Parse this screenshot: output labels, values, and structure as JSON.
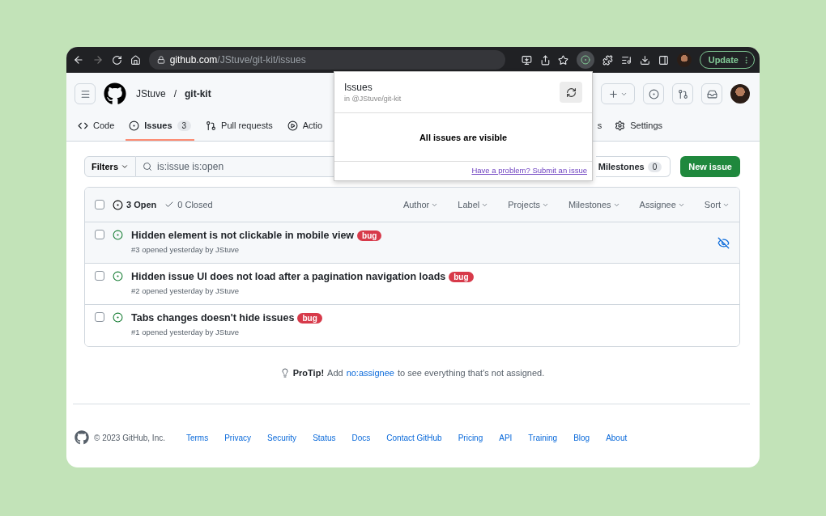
{
  "browser": {
    "url_host": "github.com",
    "url_path": "/JStuve/git-kit/issues",
    "update_button": "Update",
    "extension_active": true
  },
  "repo": {
    "owner": "JStuve",
    "separator": "/",
    "name": "git-kit"
  },
  "tabs_left": [
    {
      "label": "Code",
      "selected": false
    },
    {
      "label": "Issues",
      "count": "3",
      "selected": true
    },
    {
      "label": "Pull requests",
      "selected": false
    },
    {
      "label": "Actio",
      "selected": false
    }
  ],
  "tabs_right": [
    {
      "label": "s",
      "selected": false
    },
    {
      "label": "Settings",
      "selected": false
    }
  ],
  "filters": {
    "button": "Filters",
    "search_value": "is:issue is:open",
    "milestones": "Milestones",
    "milestones_count": "0",
    "new_issue": "New issue"
  },
  "list_header": {
    "checked": false,
    "open": "3 Open",
    "closed": "0 Closed",
    "menus": [
      "Author",
      "Label",
      "Projects",
      "Milestones",
      "Assignee",
      "Sort"
    ]
  },
  "issues": [
    {
      "title": "Hidden element is not clickable in mobile view",
      "label": "bug",
      "meta": "#3 opened yesterday by JStuve",
      "checked": false,
      "hidden": true
    },
    {
      "title": "Hidden issue UI does not load after a pagination navigation loads",
      "label": "bug",
      "meta": "#2 opened yesterday by JStuve",
      "checked": false,
      "hidden": false
    },
    {
      "title": "Tabs changes doesn't hide issues",
      "label": "bug",
      "meta": "#1 opened yesterday by JStuve",
      "checked": false,
      "hidden": false
    }
  ],
  "protip": {
    "lead": "ProTip!",
    "before": "Add",
    "link": "no:assignee",
    "after": "to see everything that's not assigned."
  },
  "footer": {
    "copyright": "© 2023 GitHub, Inc.",
    "links": [
      "Terms",
      "Privacy",
      "Security",
      "Status",
      "Docs",
      "Contact GitHub",
      "Pricing",
      "API",
      "Training",
      "Blog",
      "About"
    ]
  },
  "popup": {
    "title": "Issues",
    "subtitle": "in @JStuve/git-kit",
    "message": "All issues are visible",
    "link": "Have a problem? Submit an issue"
  }
}
